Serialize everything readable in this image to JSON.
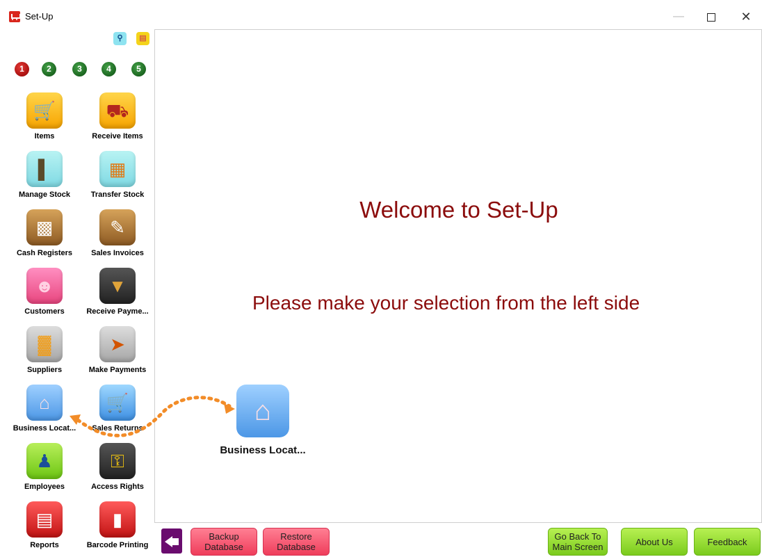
{
  "window": {
    "title": "Set-Up",
    "controls": {
      "minimize": "—",
      "close": "✕"
    }
  },
  "toolbar": {
    "search_icon": "search-icon",
    "chat_icon": "chat-icon"
  },
  "steps": [
    "1",
    "2",
    "3",
    "4",
    "5"
  ],
  "sidebar": {
    "items": [
      {
        "label": "Items",
        "icon": "shopping-cart-icon"
      },
      {
        "label": "Receive Items",
        "icon": "delivery-truck-icon"
      },
      {
        "label": "Manage Stock",
        "icon": "hand-truck-icon"
      },
      {
        "label": "Transfer Stock",
        "icon": "transfer-boxes-icon"
      },
      {
        "label": "Cash Registers",
        "icon": "cash-register-icon"
      },
      {
        "label": "Sales Invoices",
        "icon": "invoice-icon"
      },
      {
        "label": "Customers",
        "icon": "customers-icon"
      },
      {
        "label": "Receive Payme...",
        "icon": "receive-payment-icon"
      },
      {
        "label": "Suppliers",
        "icon": "factory-icon"
      },
      {
        "label": "Make Payments",
        "icon": "make-payment-icon"
      },
      {
        "label": "Business Locat...",
        "icon": "store-icon"
      },
      {
        "label": "Sales Returns",
        "icon": "return-cart-icon"
      },
      {
        "label": "Employees",
        "icon": "employee-icon"
      },
      {
        "label": "Access Rights",
        "icon": "lock-key-icon"
      },
      {
        "label": "Reports",
        "icon": "scroll-icon"
      },
      {
        "label": "Barcode Printing",
        "icon": "barcode-icon"
      }
    ]
  },
  "main": {
    "welcome": "Welcome to Set-Up",
    "instruction": "Please make your selection from the left side",
    "preview_label": "Business Locat..."
  },
  "footer": {
    "backup": "Backup Database",
    "restore": "Restore Database",
    "go_back": "Go Back To Main Screen",
    "about": "About Us",
    "feedback": "Feedback"
  },
  "colors": {
    "heading": "#8b0c0c",
    "pink_button": "#ef3d5b",
    "green_button": "#7bcb1d",
    "back_button": "#6a0c6e",
    "dotted_arrow": "#f28c28"
  }
}
